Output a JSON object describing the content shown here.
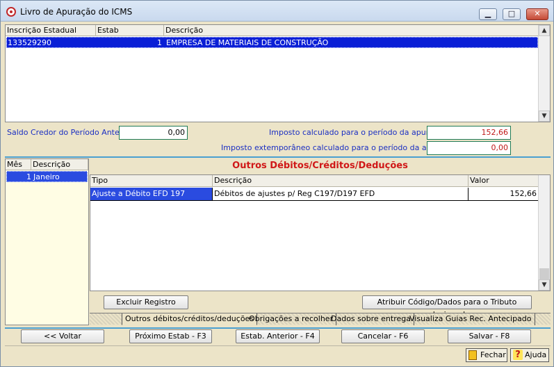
{
  "window": {
    "title": "Livro de Apuração do ICMS"
  },
  "grid1": {
    "headers": [
      "Inscrição Estadual",
      "Estab Centralizador",
      "Descrição"
    ],
    "row": {
      "inscricao": "133529290",
      "estab": "1",
      "descricao": "EMPRESA DE MATERIAIS DE CONSTRUÇÃO"
    }
  },
  "totals": {
    "saldo_label": "Saldo Credor do Período Anterior",
    "saldo_value": "0,00",
    "imposto_label": "Imposto calculado para o período da apuração",
    "imposto_value": "152,66",
    "extemp_label": "Imposto extemporâneo calculado para o período da apuração",
    "extemp_value": "0,00"
  },
  "months": {
    "headers": [
      "Mês",
      "Descrição"
    ],
    "row": {
      "mes": "1",
      "descricao": "Janeiro"
    }
  },
  "section": {
    "title": "Outros Débitos/Créditos/Deduções"
  },
  "grid2": {
    "headers": [
      "Tipo",
      "Descrição",
      "Valor"
    ],
    "row": {
      "tipo": "Ajuste a Débito EFD 197",
      "descricao": "Débitos de  ajustes p/ Reg C197/D197 EFD",
      "valor": "152,66"
    }
  },
  "actions": {
    "excluir": "Excluir Registro",
    "atribuir": "Atribuir Código/Dados para o Tributo selecionado"
  },
  "tabs": [
    "Outros débitos/créditos/deduções",
    "Obrigações a recolher",
    "Dados sobre entrega",
    "Visualiza Guias Rec. Antecipado"
  ],
  "nav": {
    "voltar": "<< Voltar",
    "proximo": "Próximo Estab - F3",
    "anterior": "Estab. Anterior - F4",
    "cancelar": "Cancelar - F6",
    "salvar": "Salvar - F8"
  },
  "footer": {
    "fechar": "Fechar",
    "ajuda": "Ajuda"
  },
  "colors": {
    "accent": "#0a1fd6",
    "highlight_text": "#c01818",
    "separator": "#4a9fd0"
  }
}
